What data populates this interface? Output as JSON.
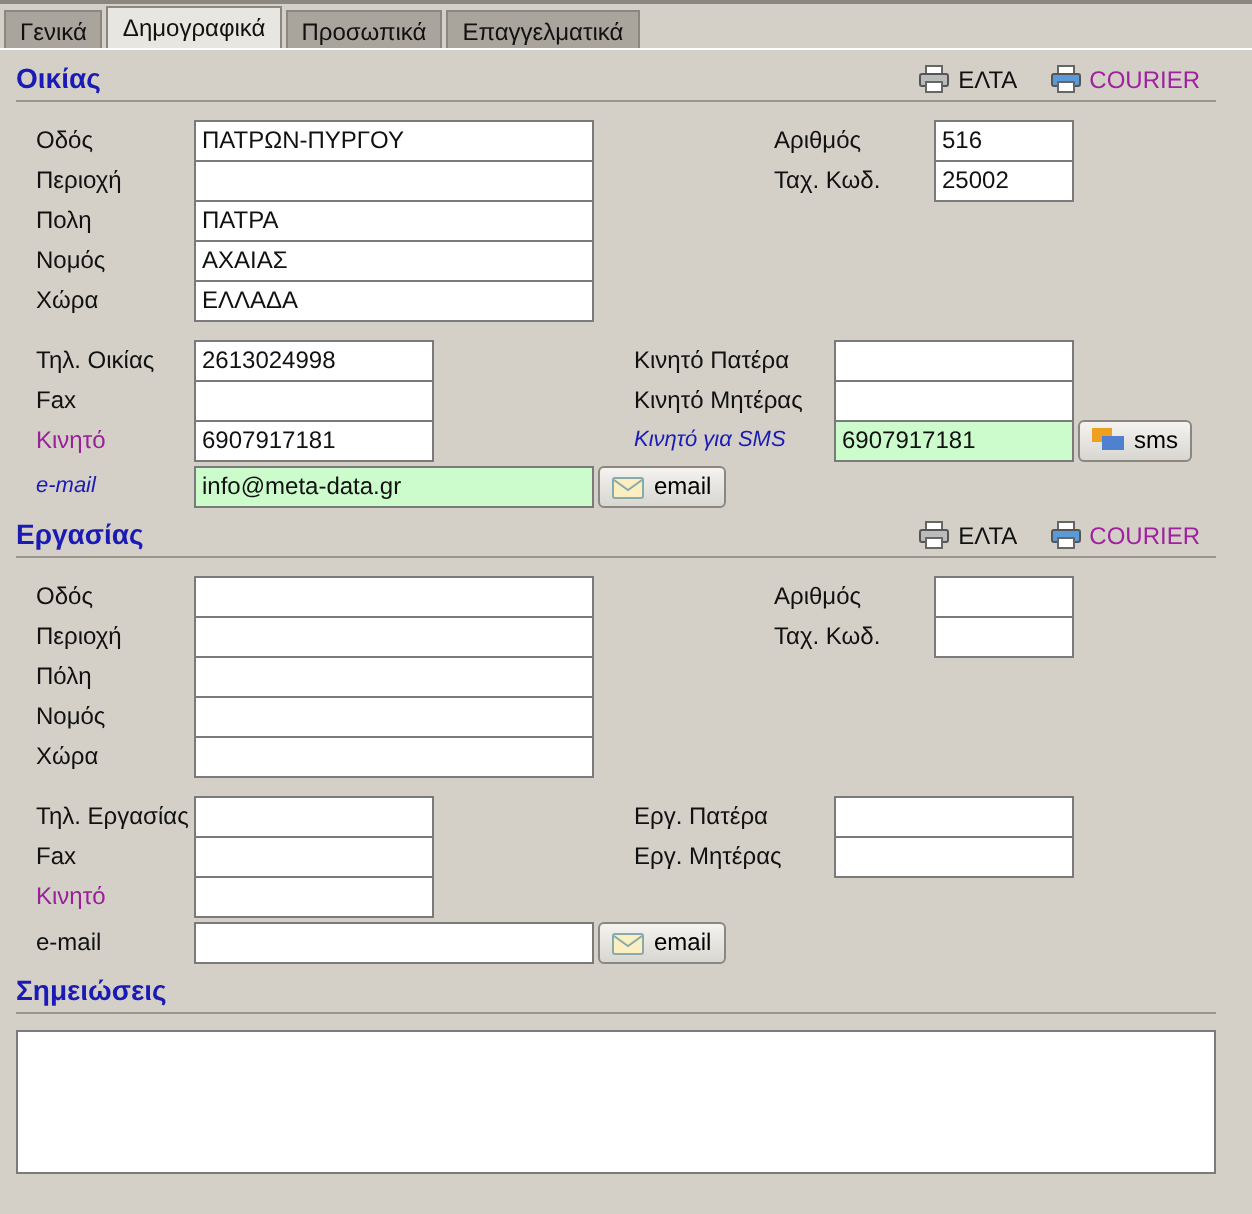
{
  "tabs": [
    {
      "label": "Γενικά",
      "selected": false
    },
    {
      "label": "Δημογραφικά",
      "selected": true
    },
    {
      "label": "Προσωπικά",
      "selected": false
    },
    {
      "label": "Επαγγελματικά",
      "selected": false
    }
  ],
  "sections": [
    {
      "title": "Οικίας",
      "print_buttons": [
        {
          "label": "ΕΛΤΑ",
          "kind": "post"
        },
        {
          "label": "COURIER",
          "kind": "courier"
        }
      ],
      "address_left": [
        {
          "label": "Οδός",
          "value": "ΠΑΤΡΩΝ-ΠΥΡΓΟΥ"
        },
        {
          "label": "Περιοχή"
        },
        {
          "label": "Πολη",
          "value": "ΠΑΤΡΑ"
        },
        {
          "label": "Νομός",
          "value": "ΑΧΑΙΑΣ"
        },
        {
          "label": "Χώρα",
          "value": "ΕΛΛΑΔΑ"
        }
      ],
      "address_right": [
        {
          "label": "Αριθμός",
          "value": "516"
        },
        {
          "label": "Ταχ. Κωδ.",
          "value": "25002"
        }
      ],
      "phone_left": [
        {
          "label": "Τηλ. Οικίας",
          "kind": "plain",
          "value": "2613024998",
          "highlighted": false
        },
        {
          "label": "Fax",
          "kind": "plain",
          "highlighted": false
        },
        {
          "label": "Κινητό",
          "kind": "mobile",
          "value": "6907917181",
          "highlighted": false
        }
      ],
      "phone_right": [
        {
          "label": "Κινητό Πατέρα",
          "kind": "plain",
          "highlighted": false
        },
        {
          "label": "Κινητό Μητέρας",
          "kind": "plain",
          "highlighted": false
        },
        {
          "label": "Κινητό για SMS",
          "kind": "italic",
          "value": "6907917181",
          "highlighted": true,
          "button": "sms"
        }
      ],
      "email": {
        "label": "e-mail",
        "kind": "italic",
        "value": "info@meta-data.gr",
        "highlighted": true,
        "button": "email"
      }
    },
    {
      "title": "Εργασίας",
      "print_buttons": [
        {
          "label": "ΕΛΤΑ",
          "kind": "post"
        },
        {
          "label": "COURIER",
          "kind": "courier"
        }
      ],
      "address_left": [
        {
          "label": "Οδός"
        },
        {
          "label": "Περιοχή"
        },
        {
          "label": "Πόλη"
        },
        {
          "label": "Νομός"
        },
        {
          "label": "Χώρα"
        }
      ],
      "address_right": [
        {
          "label": "Αριθμός"
        },
        {
          "label": "Ταχ. Κωδ."
        }
      ],
      "phone_left": [
        {
          "label": "Τηλ. Εργασίας",
          "kind": "plain",
          "highlighted": false
        },
        {
          "label": "Fax",
          "kind": "plain",
          "highlighted": false
        },
        {
          "label": "Κινητό",
          "kind": "mobile",
          "highlighted": false
        }
      ],
      "phone_right": [
        {
          "label": "Εργ. Πατέρα",
          "kind": "plain",
          "highlighted": false
        },
        {
          "label": "Εργ. Μητέρας",
          "kind": "plain",
          "highlighted": false
        }
      ],
      "email": {
        "label": "e-mail",
        "kind": "plain",
        "highlighted": false,
        "button": "email"
      }
    }
  ],
  "notes": {
    "title": "Σημειώσεις"
  }
}
